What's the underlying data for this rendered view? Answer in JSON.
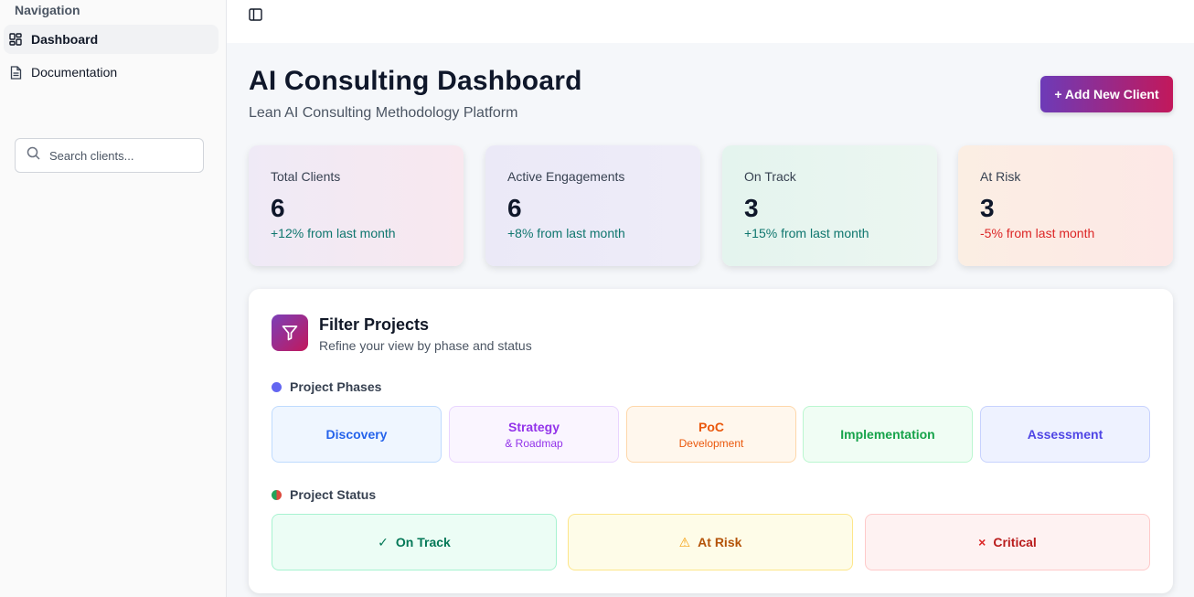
{
  "sidebar": {
    "heading": "Navigation",
    "items": [
      {
        "label": "Dashboard",
        "icon": "dashboard-grid-icon",
        "active": true
      },
      {
        "label": "Documentation",
        "icon": "document-icon",
        "active": false
      }
    ],
    "search": {
      "placeholder": "Search clients...",
      "value": ""
    }
  },
  "header": {
    "title": "AI Consulting Dashboard",
    "subtitle": "Lean AI Consulting Methodology Platform",
    "add_button": "+ Add New Client"
  },
  "stats": [
    {
      "label": "Total Clients",
      "value": "6",
      "change": "+12% from last month",
      "change_color": "#0f766e"
    },
    {
      "label": "Active Engagements",
      "value": "6",
      "change": "+8% from last month",
      "change_color": "#0f766e"
    },
    {
      "label": "On Track",
      "value": "3",
      "change": "+15% from last month",
      "change_color": "#0f766e"
    },
    {
      "label": "At Risk",
      "value": "3",
      "change": "-5% from last month",
      "change_color": "#dc2626"
    }
  ],
  "filter": {
    "title": "Filter Projects",
    "subtitle": "Refine your view by phase and status",
    "phases_heading": "Project Phases",
    "phases": [
      {
        "label": "Discovery",
        "sublabel": ""
      },
      {
        "label": "Strategy",
        "sublabel": "& Roadmap"
      },
      {
        "label": "PoC",
        "sublabel": "Development"
      },
      {
        "label": "Implementation",
        "sublabel": ""
      },
      {
        "label": "Assessment",
        "sublabel": ""
      }
    ],
    "status_heading": "Project Status",
    "statuses": [
      {
        "label": "On Track",
        "icon": "checkmark-icon",
        "glyph": "✓"
      },
      {
        "label": "At Risk",
        "icon": "warning-icon",
        "glyph": "⚠"
      },
      {
        "label": "Critical",
        "icon": "close-icon",
        "glyph": "×"
      }
    ]
  },
  "colors": {
    "accent_start": "#6d3bb8",
    "accent_end": "#c2185b",
    "positive": "#0f766e",
    "negative": "#dc2626"
  }
}
